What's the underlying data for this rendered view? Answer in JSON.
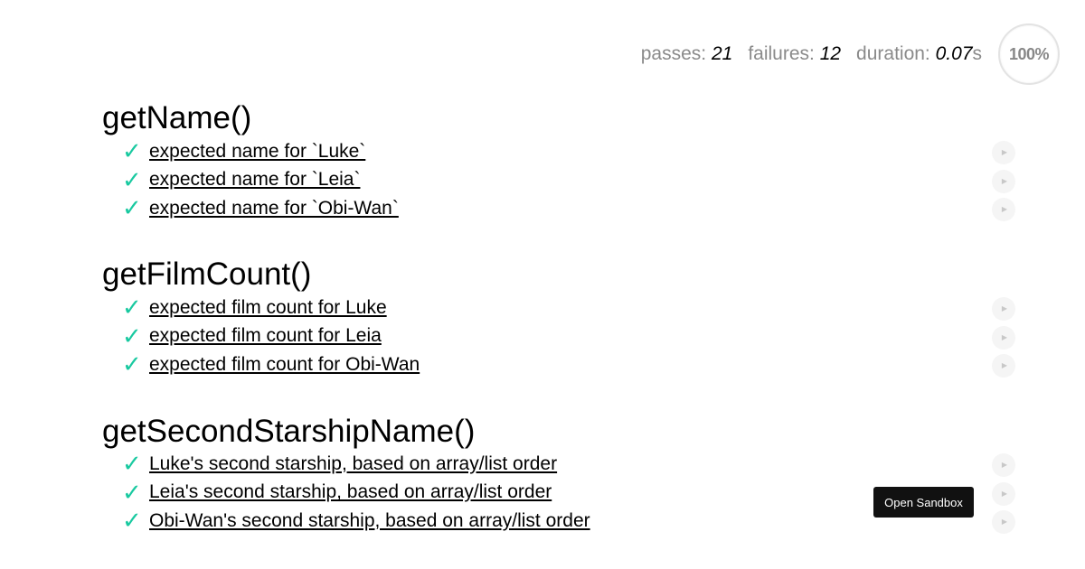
{
  "stats": {
    "passes_label": "passes:",
    "passes_value": "21",
    "failures_label": "failures:",
    "failures_value": "12",
    "duration_label": "duration:",
    "duration_value": "0.07",
    "duration_unit": "s",
    "progress_text": "100%",
    "progress_fraction": 1.0
  },
  "suites": [
    {
      "title": "getName()",
      "tests": [
        {
          "check": "✓",
          "title": "expected name for `Luke`"
        },
        {
          "check": "✓",
          "title": "expected name for `Leia`"
        },
        {
          "check": "✓",
          "title": "expected name for `Obi-Wan`"
        }
      ]
    },
    {
      "title": "getFilmCount()",
      "tests": [
        {
          "check": "✓",
          "title": "expected film count for Luke"
        },
        {
          "check": "✓",
          "title": "expected film count for Leia"
        },
        {
          "check": "✓",
          "title": "expected film count for Obi-Wan"
        }
      ]
    },
    {
      "title": "getSecondStarshipName()",
      "tests": [
        {
          "check": "✓",
          "title": "Luke's second starship, based on array/list order"
        },
        {
          "check": "✓",
          "title": "Leia's second starship, based on array/list order"
        },
        {
          "check": "✓",
          "title": "Obi-Wan's second starship, based on array/list order"
        }
      ]
    }
  ],
  "run_icon": "play-icon",
  "tooltip": "Open Sandbox",
  "colors": {
    "pass": "#19c9a0",
    "muted": "#8a8a8a"
  }
}
